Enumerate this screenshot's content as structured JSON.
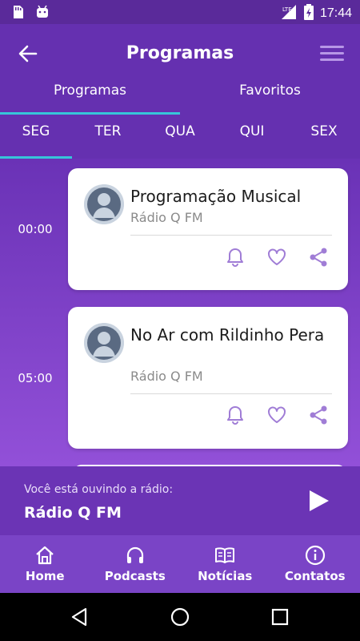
{
  "status_bar": {
    "time": "17:44",
    "network": "LTE"
  },
  "header": {
    "title": "Programas"
  },
  "tabs": [
    {
      "label": "Programas",
      "active": true
    },
    {
      "label": "Favoritos",
      "active": false
    }
  ],
  "days": [
    {
      "label": "SEG",
      "active": true
    },
    {
      "label": "TER"
    },
    {
      "label": "QUA"
    },
    {
      "label": "QUI"
    },
    {
      "label": "SEX"
    }
  ],
  "schedule": [
    {
      "time": "00:00",
      "title": "Programação Musical",
      "station": "Rádio Q FM"
    },
    {
      "time": "05:00",
      "title": "No Ar com Rildinho Pera",
      "station": "Rádio Q FM"
    }
  ],
  "player": {
    "label": "Você está ouvindo a rádio:",
    "station": "Rádio Q FM"
  },
  "bottom_nav": [
    {
      "label": "Home",
      "icon": "home-icon"
    },
    {
      "label": "Podcasts",
      "icon": "headphones-icon"
    },
    {
      "label": "Notícias",
      "icon": "book-icon"
    },
    {
      "label": "Contatos",
      "icon": "info-icon"
    }
  ],
  "colors": {
    "primary": "#6530b0",
    "accent": "#37c5d9",
    "card_icon": "#a07dd6"
  }
}
